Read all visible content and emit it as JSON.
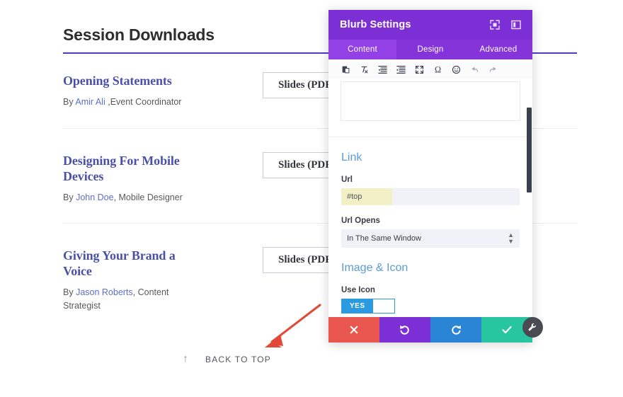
{
  "page": {
    "title": "Session Downloads",
    "sessions": [
      {
        "name": "Opening Statements",
        "by_prefix": "By ",
        "author": "Amir Ali",
        "role": " ,Event Coordinator",
        "button": "Slides (PDF)"
      },
      {
        "name": "Designing For Mobile Devices",
        "by_prefix": "By ",
        "author": "John Doe",
        "role": ", Mobile Designer",
        "button": "Slides (PDF)"
      },
      {
        "name": "Giving Your Brand a Voice",
        "by_prefix": "By ",
        "author": "Jason Roberts",
        "role": ", Content Strategist",
        "button": "Slides (PDF)"
      }
    ],
    "back_to_top": {
      "arrow": "↑",
      "label": "BACK TO TOP"
    },
    "annotation": {
      "type": "arrow",
      "color": "#e04a36"
    }
  },
  "panel": {
    "title": "Blurb Settings",
    "header_icons": [
      "expand-icon",
      "layout-panel-icon"
    ],
    "tabs": [
      {
        "label": "Content",
        "active": true
      },
      {
        "label": "Design",
        "active": false
      },
      {
        "label": "Advanced",
        "active": false
      }
    ],
    "toolbar_icons": [
      "paste-icon",
      "clear-formatting-icon",
      "outdent-icon",
      "indent-icon",
      "fullscreen-icon",
      "special-character-icon",
      "emoji-icon",
      "undo-icon",
      "redo-icon"
    ],
    "editor": {
      "value": ""
    },
    "link_section": {
      "heading": "Link",
      "url_label": "Url",
      "url_value": "#top",
      "url_opens_label": "Url Opens",
      "url_opens_value": "In The Same Window"
    },
    "image_icon_section": {
      "heading": "Image & Icon",
      "use_icon_label": "Use Icon",
      "use_icon_value": "YES"
    },
    "actions": [
      {
        "name": "cancel",
        "glyph": "✕",
        "color": "#e8564e"
      },
      {
        "name": "undo",
        "glyph": "↺",
        "color": "#7b2fd4"
      },
      {
        "name": "redo",
        "glyph": "↻",
        "color": "#2b85d6"
      },
      {
        "name": "save",
        "glyph": "✓",
        "color": "#27c6a0"
      }
    ],
    "handle_icon": "wrench-icon"
  },
  "colors": {
    "panel_header": "#7b2fd4",
    "panel_tabs": "#8434d8",
    "tab_active": "#9341e6",
    "title_rule": "#4c3fbe",
    "session_name": "#4a50a8",
    "author_link": "#5b6fc4",
    "section_heading": "#5b9bd8",
    "toggle_on": "#2b9ae0",
    "autofill": "#f3efc6",
    "input_bg": "#f0f2f7",
    "scrollbar": "#39414f"
  }
}
